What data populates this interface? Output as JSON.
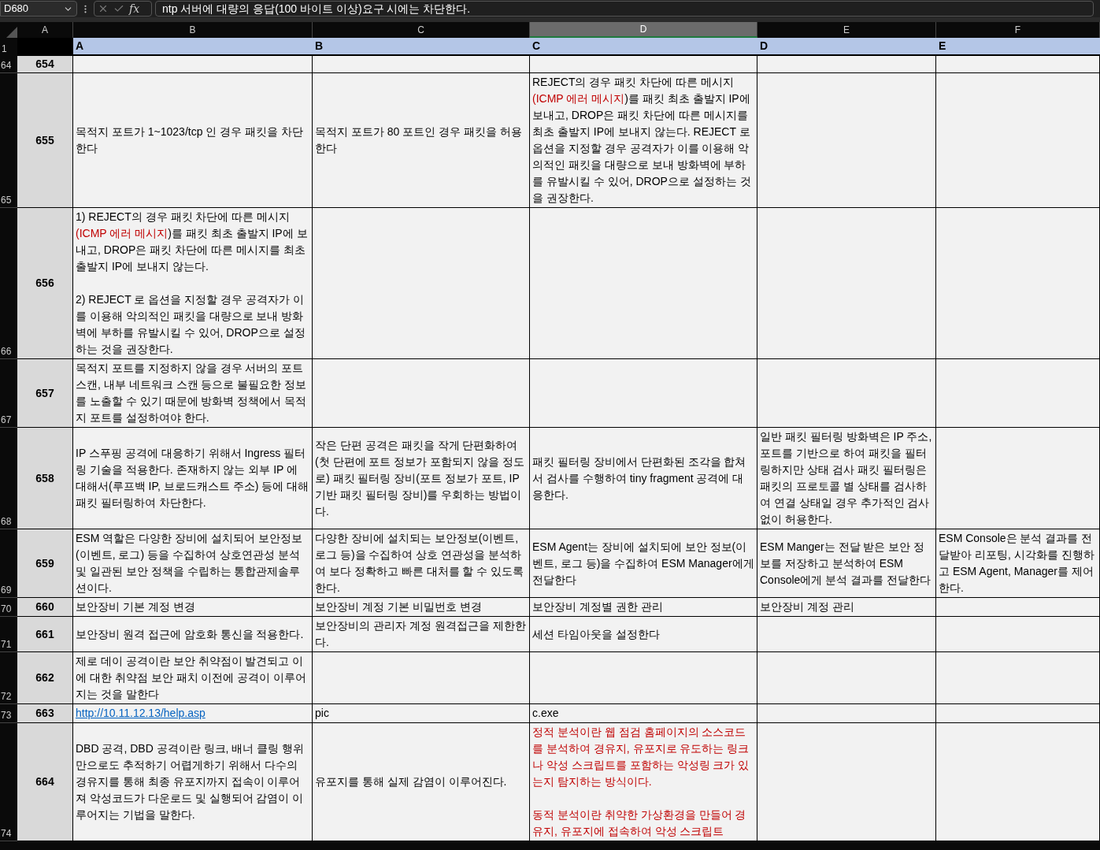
{
  "formula_bar": {
    "name_box": "D680",
    "function_label": "fx",
    "formula": "ntp 서버에 대량의 응답(100 바이트 이상)요구 시에는 차단한다."
  },
  "column_headers": [
    {
      "label": "A",
      "selected": false
    },
    {
      "label": "B",
      "selected": false
    },
    {
      "label": "C",
      "selected": false
    },
    {
      "label": "D",
      "selected": true
    },
    {
      "label": "E",
      "selected": false
    },
    {
      "label": "F",
      "selected": false
    }
  ],
  "header_row": {
    "row_label": "1",
    "cells": [
      "A",
      "B",
      "C",
      "D",
      "E"
    ]
  },
  "rows": [
    {
      "row_label": "64",
      "number": "654",
      "cells": [
        null,
        null,
        null,
        null,
        null
      ]
    },
    {
      "row_label": "65",
      "number": "655",
      "cells": [
        [
          {
            "text": "목적지 포트가 1~1023/tcp 인 경우 패킷을 차단한다",
            "kind": "plain"
          }
        ],
        [
          {
            "text": "목적지 포트가 80 포트인 경우 패킷을 허용한다",
            "kind": "plain"
          }
        ],
        [
          {
            "text": "REJECT의 경우 패킷 차단에 따른 메시지 ",
            "kind": "plain"
          },
          {
            "text": "(ICMP 에러 메시지",
            "kind": "accent"
          },
          {
            "text": ")를 패킷 최초 출발지 IP에 보내고, DROP은 패킷 차단에 따른 메시지를 최초 출발지 IP에 보내지 않는다. REJECT 로 옵션을 지정할 경우 공격자가 이를 이용해 악의적인 패킷을 대량으로 보내 방화벽에 부하를 유발시킬 수 있어, DROP으로 설정하는 것을 권장한다.",
            "kind": "plain"
          }
        ],
        null,
        null
      ]
    },
    {
      "row_label": "66",
      "number": "656",
      "cells": [
        [
          {
            "text": "1) REJECT의 경우 패킷 차단에 따른 메시지 ",
            "kind": "plain"
          },
          {
            "text": "(ICMP 에러 메시지",
            "kind": "accent"
          },
          {
            "text": ")를 패킷 최초 출발지 IP에 보내고, DROP은 패킷 차단에 따른 메시지를 최초 출발지 IP에 보내지 않는다.\n\n2) REJECT 로 옵션을 지정할 경우 공격자가 이를 이용해 악의적인 패킷을 대량으로 보내 방화벽에 부하를 유발시킬 수 있어, DROP으로 설정하는 것을 권장한다.",
            "kind": "plain"
          }
        ],
        null,
        null,
        null,
        null
      ]
    },
    {
      "row_label": "67",
      "number": "657",
      "cells": [
        [
          {
            "text": "목적지 포트를 지정하지 않을 경우 서버의 포트 스캔, 내부 네트워크 스캔 등으로 불필요한 정보를 노출할 수 있기 때문에 방화벽 정책에서 목적지 포트를 설정하여야 한다.",
            "kind": "plain"
          }
        ],
        null,
        null,
        null,
        null
      ]
    },
    {
      "row_label": "68",
      "number": "658",
      "cells": [
        [
          {
            "text": "IP 스푸핑 공격에 대응하기 위해서 Ingress 필터링 기술을 적용한다. 존재하지 않는 외부 IP 에 대해서(루프백 IP, 브로드캐스트 주소) 등에 대해 패킷 필터링하여 차단한다.",
            "kind": "plain"
          }
        ],
        [
          {
            "text": "작은 단편 공격은 패킷을 작게 단편화하여(첫 단편에 포트 정보가 포함되지 않을 정도로) 패킷 필터링 장비(포트 정보가 포트, IP 기반 패킷 필터링 장비)를 우회하는 방법이다.",
            "kind": "plain"
          }
        ],
        [
          {
            "text": "패킷 필터링 장비에서 단편화된 조각을 합쳐서 검사를 수행하여 tiny fragment 공격에 대응한다.",
            "kind": "plain"
          }
        ],
        [
          {
            "text": "일반 패킷 필터링 방화벽은 IP 주소, 포트를 기반으로 하여 패킷을 필터링하지만 상태 검사 패킷 필터링은 패킷의 프로토콜 별 상태를 검사하여 연결 상태일 경우 추가적인 검사없이 허용한다.",
            "kind": "plain"
          }
        ],
        null
      ]
    },
    {
      "row_label": "69",
      "number": "659",
      "cells": [
        [
          {
            "text": "ESM 역할은 다양한 장비에 설치되어 보안정보(이벤트, 로그) 등을 수집하여 상호연관성 분석 및 일관된 보안 정책을 수립하는 통합관제솔루션이다.",
            "kind": "plain"
          }
        ],
        [
          {
            "text": "다양한 장비에 설치되는 보안정보(이벤트, 로그 등)을 수집하여 상호 연관성을 분석하여 보다 정확하고 빠른 대처를 할 수 있도록 한다.",
            "kind": "plain"
          }
        ],
        [
          {
            "text": "ESM Agent는 장비에 설치되에 보안 정보(이벤트, 로그 등)을 수집하여 ESM Manager에게 전달한다",
            "kind": "plain"
          }
        ],
        [
          {
            "text": "ESM Manger는 전달 받은 보안 정보를 저장하고 분석하여 ESM Console에게 분석 결과를 전달한다",
            "kind": "plain"
          }
        ],
        [
          {
            "text": "ESM Console은 분석 결과를 전달받아 리포팅, 시각화를 진행하고 ESM Agent, Manager를 제어한다.",
            "kind": "plain"
          }
        ]
      ]
    },
    {
      "row_label": "70",
      "number": "660",
      "cells": [
        [
          {
            "text": "보안장비 기본 계정 변경",
            "kind": "plain"
          }
        ],
        [
          {
            "text": "보안장비 계정 기본 비밀번호 변경",
            "kind": "plain"
          }
        ],
        [
          {
            "text": "보안장비 계정별 권한 관리",
            "kind": "plain"
          }
        ],
        [
          {
            "text": "보안장비 계정 관리",
            "kind": "plain"
          }
        ],
        null
      ]
    },
    {
      "row_label": "71",
      "number": "661",
      "cells": [
        [
          {
            "text": "보안장비 원격 접근에 암호화 통신을 적용한다.",
            "kind": "plain"
          }
        ],
        [
          {
            "text": "보안장비의 관리자 계정 원격접근을 제한한다.",
            "kind": "plain"
          }
        ],
        [
          {
            "text": "세션 타임아웃을 설정한다",
            "kind": "plain"
          }
        ],
        null,
        null
      ]
    },
    {
      "row_label": "72",
      "number": "662",
      "cells": [
        [
          {
            "text": "제로 데이 공격이란 보안 취약점이 발견되고 이에 대한 취약점 보안 패치 이전에 공격이 이루어지는 것을 말한다",
            "kind": "plain"
          }
        ],
        null,
        null,
        null,
        null
      ]
    },
    {
      "row_label": "73",
      "number": "663",
      "cells": [
        [
          {
            "text": "http://10.11.12.13/help.asp",
            "kind": "link"
          }
        ],
        [
          {
            "text": "pic",
            "kind": "plain"
          }
        ],
        [
          {
            "text": "c.exe",
            "kind": "plain"
          }
        ],
        null,
        null
      ]
    },
    {
      "row_label": "74",
      "number": "664",
      "cells": [
        [
          {
            "text": "DBD 공격, DBD 공격이란 링크, 배너 클링 행위만으로도 추적하기 어렵게하기 위해서 다수의 경유지를 통해 최종 유포지까지 접속이 이루어져 악성코드가 다운로드 및 실행되어 감염이 이루어지는 기법을 말한다.",
            "kind": "plain"
          }
        ],
        [
          {
            "text": "유포지를 통해 실제 감염이 이루어진다.",
            "kind": "plain"
          }
        ],
        [
          {
            "text": "정적 분석이란 웹 점검 홈페이지의 소스코드를 분석하여 경유지, 유포지로 유도하는 링크나 악성 스크립트를 포함하는 악성링 크가 있는지 탐지하는 방식이다.\n\n동적 분석이란 취약한 가상환경을 만들어 경유지, 유포지에 접속하여 악성 스크립트",
            "kind": "accent"
          }
        ],
        null,
        null
      ]
    }
  ]
}
